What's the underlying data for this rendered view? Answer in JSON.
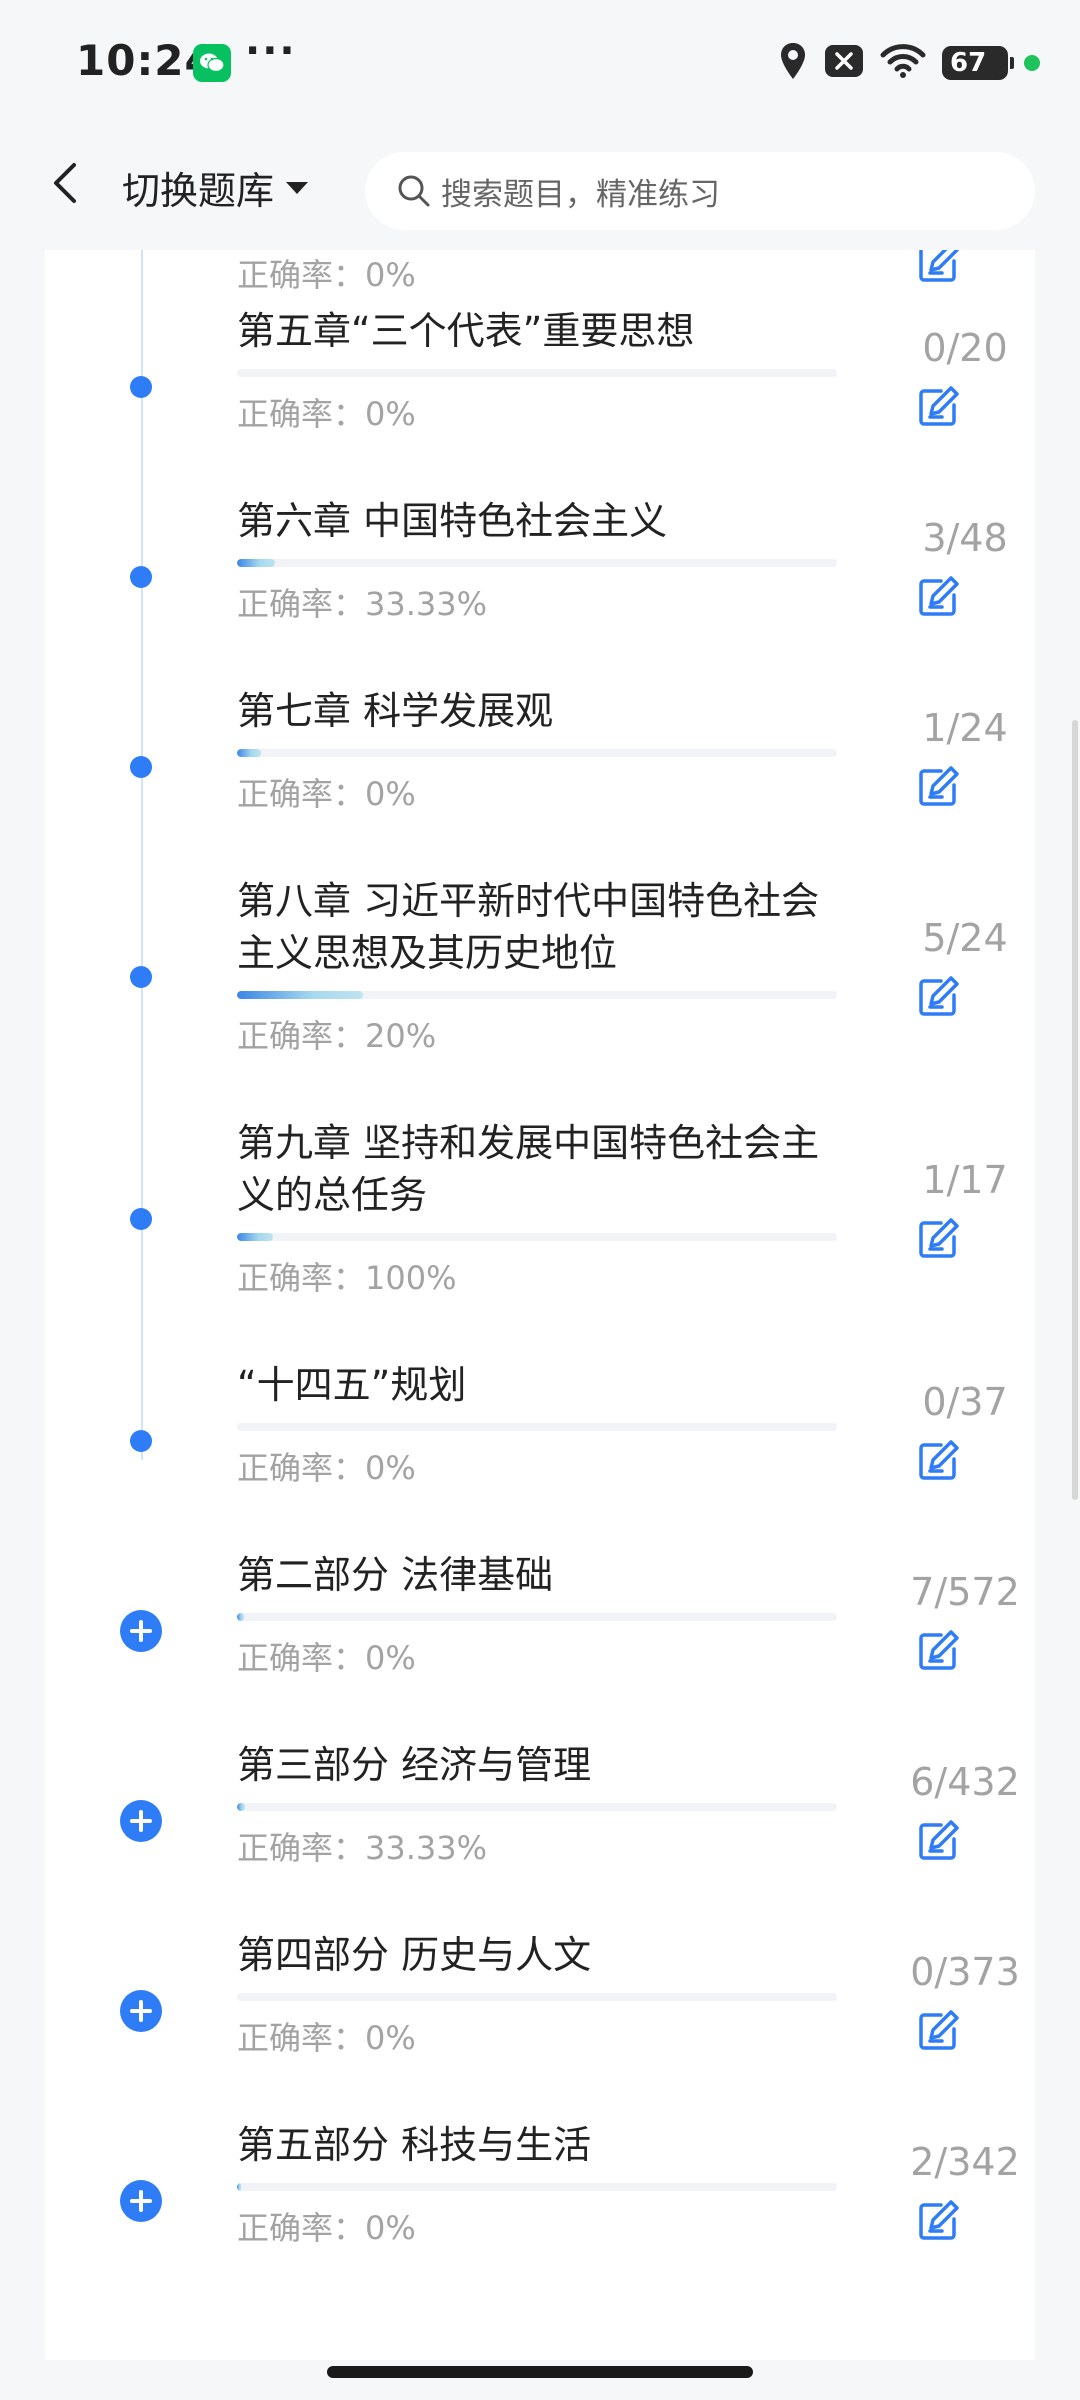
{
  "status_bar": {
    "time": "10:24",
    "dots": "···",
    "battery": "67"
  },
  "header": {
    "switch_label": "切换题库",
    "search_placeholder": "搜索题目，精准练习"
  },
  "accuracy_prefix": "正确率：",
  "items": [
    {
      "title": "",
      "accuracy": "0%",
      "count": "",
      "progress": 0,
      "bullet": "none"
    },
    {
      "title": "第五章“三个代表”重要思想",
      "accuracy": "0%",
      "count": "0/20",
      "progress": 0,
      "bullet": "dot"
    },
    {
      "title": "第六章 中国特色社会主义",
      "accuracy": "33.33%",
      "count": "3/48",
      "progress": 0.0625,
      "bullet": "dot"
    },
    {
      "title": "第七章 科学发展观",
      "accuracy": "0%",
      "count": "1/24",
      "progress": 0.04,
      "bullet": "dot"
    },
    {
      "title": "第八章 习近平新时代中国特色社会主义思想及其历史地位",
      "accuracy": "20%",
      "count": "5/24",
      "progress": 0.21,
      "bullet": "dot"
    },
    {
      "title": "第九章 坚持和发展中国特色社会主义的总任务",
      "accuracy": "100%",
      "count": "1/17",
      "progress": 0.06,
      "bullet": "dot"
    },
    {
      "title": "“十四五”规划",
      "accuracy": "0%",
      "count": "0/37",
      "progress": 0,
      "bullet": "dot"
    },
    {
      "title": "第二部分 法律基础",
      "accuracy": "0%",
      "count": "7/572",
      "progress": 0.012,
      "bullet": "plus"
    },
    {
      "title": "第三部分 经济与管理",
      "accuracy": "33.33%",
      "count": "6/432",
      "progress": 0.014,
      "bullet": "plus"
    },
    {
      "title": "第四部分 历史与人文",
      "accuracy": "0%",
      "count": "0/373",
      "progress": 0,
      "bullet": "plus"
    },
    {
      "title": "第五部分 科技与生活",
      "accuracy": "0%",
      "count": "2/342",
      "progress": 0.006,
      "bullet": "plus"
    }
  ]
}
